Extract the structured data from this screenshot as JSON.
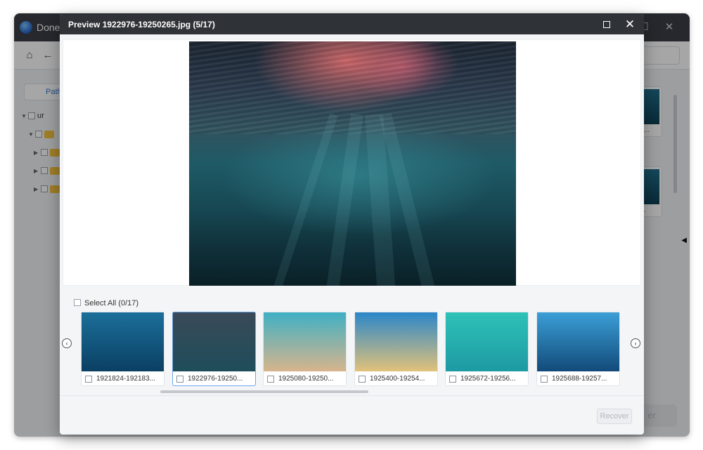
{
  "app": {
    "title": "Done",
    "path_tab": "Path",
    "tree_label": "ur",
    "right_thumb_labels": [
      "0...",
      "..."
    ],
    "recover_label": "er"
  },
  "dialog": {
    "title": "Preview 1922976-19250265.jpg (5/17)",
    "select_all": "Select All (0/17)",
    "recover_button": "Recover"
  },
  "thumbnails": [
    {
      "name": "1921824-192183...",
      "selected": false,
      "colors": [
        "#1b6f9a",
        "#0b3f63"
      ]
    },
    {
      "name": "1922976-19250...",
      "selected": true,
      "colors": [
        "#3a4a58",
        "#1e4d5a"
      ]
    },
    {
      "name": "1925080-19250...",
      "selected": false,
      "colors": [
        "#3fb0c4",
        "#d7b48c"
      ]
    },
    {
      "name": "1925400-19254...",
      "selected": false,
      "colors": [
        "#2b86c9",
        "#e1c27a"
      ]
    },
    {
      "name": "1925672-19256...",
      "selected": false,
      "colors": [
        "#2ec2b8",
        "#1d9aa3"
      ]
    },
    {
      "name": "1925688-19257...",
      "selected": false,
      "colors": [
        "#3b9fd6",
        "#124a7a"
      ]
    }
  ],
  "icons": {
    "home": "home-icon",
    "back": "back-arrow-icon",
    "maximize": "maximize-icon",
    "close": "close-icon",
    "prev": "chevron-left-icon",
    "next": "chevron-right-icon"
  }
}
